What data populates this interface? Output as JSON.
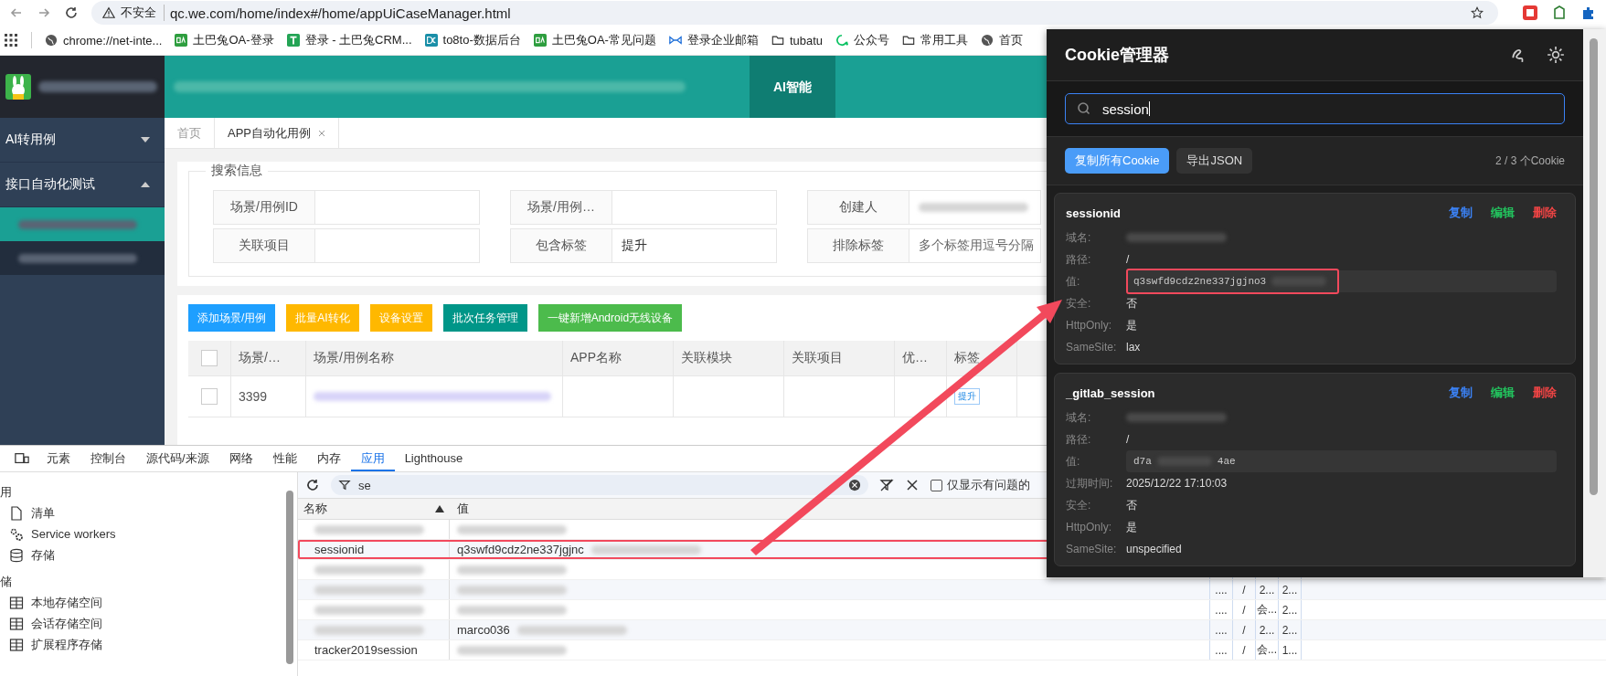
{
  "browser": {
    "security_label": "不安全",
    "url": "qc.we.com/home/index#/home/appUiCaseManager.html"
  },
  "bookmarks": [
    {
      "label": "chrome://net-inte...",
      "kind": "globe"
    },
    {
      "label": "土巴兔OA-登录",
      "kind": "oa"
    },
    {
      "label": "登录 - 土巴兔CRM...",
      "kind": "t"
    },
    {
      "label": "to8to-数据后台",
      "kind": "dc"
    },
    {
      "label": "土巴兔OA-常见问题",
      "kind": "oa"
    },
    {
      "label": "登录企业邮箱",
      "kind": "mail"
    },
    {
      "label": "tubatu",
      "kind": "folder"
    },
    {
      "label": "公众号",
      "kind": "chat"
    },
    {
      "label": "常用工具",
      "kind": "folder"
    },
    {
      "label": "首页",
      "kind": "globe"
    }
  ],
  "app": {
    "nav": [
      {
        "label": "AI智能",
        "selected": true
      }
    ],
    "sidebar": [
      {
        "label": "AI转用例",
        "expanded": false
      },
      {
        "label": "接口自动化测试",
        "expanded": true,
        "children": [
          {
            "selected": true
          },
          {
            "selected": false
          }
        ]
      }
    ],
    "page_tabs": [
      {
        "label": "首页",
        "selected": false,
        "closable": false
      },
      {
        "label": "APP自动化用例",
        "selected": true,
        "closable": true
      }
    ],
    "search": {
      "legend": "搜索信息",
      "fields": [
        {
          "label": "场景/用例ID"
        },
        {
          "label": "场景/用例…"
        },
        {
          "label": "创建人",
          "redacted": true
        },
        {
          "label": "关联项目"
        },
        {
          "label": "包含标签",
          "value": "提升"
        },
        {
          "label": "排除标签",
          "placeholder": "多个标签用逗号分隔"
        }
      ]
    },
    "buttons": [
      {
        "label": "添加场景/用例",
        "color": "#1e9fff"
      },
      {
        "label": "批量AI转化",
        "color": "#ffb800"
      },
      {
        "label": "设备设置",
        "color": "#ffb800"
      },
      {
        "label": "批次任务管理",
        "color": "#009688"
      },
      {
        "label": "一键新增Android无线设备",
        "color": "#4cbb4c"
      }
    ],
    "table": {
      "columns": [
        "场景/…",
        "场景/用例名称",
        "APP名称",
        "关联模块",
        "关联项目",
        "优…",
        "标签"
      ],
      "header_checked": false,
      "rows": [
        {
          "checked": false,
          "id": "3399",
          "tag": "提升"
        }
      ]
    }
  },
  "devtools": {
    "tabs": [
      {
        "label": "元素",
        "selected": false
      },
      {
        "label": "控制台",
        "selected": false
      },
      {
        "label": "源代码/来源",
        "selected": false
      },
      {
        "label": "网络",
        "selected": false
      },
      {
        "label": "性能",
        "selected": false
      },
      {
        "label": "内存",
        "selected": false
      },
      {
        "label": "应用",
        "selected": true
      },
      {
        "label": "Lighthouse",
        "selected": false
      }
    ],
    "sidebar": [
      {
        "label": "用",
        "kind": "heading"
      },
      {
        "label": "清单",
        "kind": "file"
      },
      {
        "label": "Service workers",
        "kind": "gear"
      },
      {
        "label": "存储",
        "kind": "database"
      },
      {
        "label": "储",
        "kind": "heading"
      },
      {
        "label": "本地存储空间",
        "kind": "table"
      },
      {
        "label": "会话存储空间",
        "kind": "table"
      },
      {
        "label": "扩展程序存储",
        "kind": "table"
      }
    ],
    "filter": "se",
    "only_issues": {
      "label": "仅显示有问题的",
      "checked": false
    },
    "columns": [
      "名称",
      "值"
    ],
    "rows": [
      {
        "highlighted": false,
        "extra": []
      },
      {
        "name": "sessionid",
        "value": "q3swfd9cdz2ne337jgjnc",
        "highlighted": true,
        "extra": []
      },
      {
        "highlighted": false,
        "extra": []
      },
      {
        "highlighted": false,
        "extra": [
          "....",
          "/",
          "2...",
          "2..."
        ]
      },
      {
        "highlighted": false,
        "extra": [
          "....",
          "/",
          "会...",
          "2..."
        ]
      },
      {
        "value": "marco036",
        "highlighted": false,
        "extra": [
          "....",
          "/",
          "2...",
          "2..."
        ]
      },
      {
        "name": "tracker2019session",
        "highlighted": false,
        "extra": [
          "....",
          "/",
          "会...",
          "1..."
        ]
      }
    ]
  },
  "cookie_panel": {
    "title": "Cookie管理器",
    "search": "session",
    "buttons": [
      {
        "label": "复制所有Cookie",
        "primary": true
      },
      {
        "label": "导出JSON",
        "primary": false
      }
    ],
    "count": "2 / 3 个Cookie",
    "cookies": [
      {
        "name": "sessionid",
        "actions": [
          {
            "label": "复制",
            "color": "#3b82f6"
          },
          {
            "label": "编辑",
            "color": "#22c55e"
          },
          {
            "label": "删除",
            "color": "#ef4444"
          }
        ],
        "fields": [
          {
            "label": "域名:",
            "kind": "redacted"
          },
          {
            "label": "路径:",
            "kind": "text",
            "value": "/"
          },
          {
            "label": "值:",
            "kind": "code",
            "value": "q3swfd9cdz2ne337jgjno3",
            "highlighted": true
          },
          {
            "label": "安全:",
            "kind": "text",
            "value": "否"
          },
          {
            "label": "HttpOnly:",
            "kind": "text",
            "value": "是"
          },
          {
            "label": "SameSite:",
            "kind": "text",
            "value": "lax"
          }
        ]
      },
      {
        "name": "_gitlab_session",
        "actions": [
          {
            "label": "复制",
            "color": "#3b82f6"
          },
          {
            "label": "编辑",
            "color": "#22c55e"
          },
          {
            "label": "删除",
            "color": "#ef4444"
          }
        ],
        "fields": [
          {
            "label": "域名:",
            "kind": "redacted"
          },
          {
            "label": "路径:",
            "kind": "text",
            "value": "/"
          },
          {
            "label": "值:",
            "kind": "code",
            "value": "d7a",
            "value_tail": "4ae",
            "highlighted": false
          },
          {
            "label": "过期时间:",
            "kind": "text",
            "value": "2025/12/22 17:10:03"
          },
          {
            "label": "安全:",
            "kind": "text",
            "value": "否"
          },
          {
            "label": "HttpOnly:",
            "kind": "text",
            "value": "是"
          },
          {
            "label": "SameSite:",
            "kind": "text",
            "value": "unspecified"
          }
        ]
      }
    ]
  }
}
